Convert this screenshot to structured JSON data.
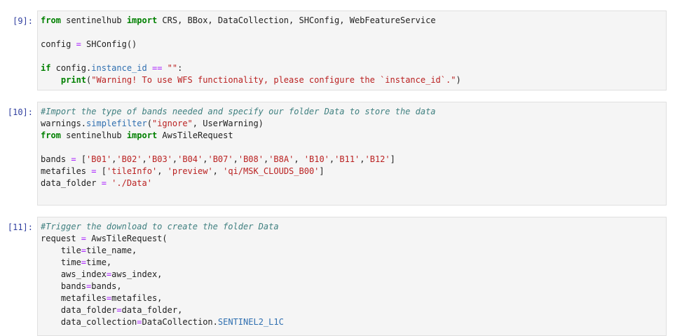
{
  "cells": [
    {
      "prompt": "[9]:",
      "lines": [
        [
          {
            "t": "from",
            "c": "kw"
          },
          {
            "t": " sentinelhub "
          },
          {
            "t": "import",
            "c": "kw"
          },
          {
            "t": " CRS, BBox, DataCollection, SHConfig, WebFeatureService"
          }
        ],
        [],
        [
          {
            "t": "config "
          },
          {
            "t": "=",
            "c": "op"
          },
          {
            "t": " SHConfig()"
          }
        ],
        [],
        [
          {
            "t": "if",
            "c": "kw"
          },
          {
            "t": " config."
          },
          {
            "t": "instance_id",
            "c": "attr"
          },
          {
            "t": " "
          },
          {
            "t": "==",
            "c": "op"
          },
          {
            "t": " "
          },
          {
            "t": "\"\"",
            "c": "str"
          },
          {
            "t": ":"
          }
        ],
        [
          {
            "t": "    "
          },
          {
            "t": "print",
            "c": "kw"
          },
          {
            "t": "("
          },
          {
            "t": "\"Warning! To use WFS functionality, please configure the `instance_id`.\"",
            "c": "str"
          },
          {
            "t": ")"
          }
        ]
      ]
    },
    {
      "prompt": "[10]:",
      "lines": [
        [
          {
            "t": "#Import the type of bands needed and specify our folder Data to store the data",
            "c": "cm"
          }
        ],
        [
          {
            "t": "warnings."
          },
          {
            "t": "simplefilter",
            "c": "attr"
          },
          {
            "t": "("
          },
          {
            "t": "\"ignore\"",
            "c": "str"
          },
          {
            "t": ", UserWarning)"
          }
        ],
        [
          {
            "t": "from",
            "c": "kw"
          },
          {
            "t": " sentinelhub "
          },
          {
            "t": "import",
            "c": "kw"
          },
          {
            "t": " AwsTileRequest"
          }
        ],
        [],
        [
          {
            "t": "bands "
          },
          {
            "t": "=",
            "c": "op"
          },
          {
            "t": " ["
          },
          {
            "t": "'B01'",
            "c": "str"
          },
          {
            "t": ","
          },
          {
            "t": "'B02'",
            "c": "str"
          },
          {
            "t": ","
          },
          {
            "t": "'B03'",
            "c": "str"
          },
          {
            "t": ","
          },
          {
            "t": "'B04'",
            "c": "str"
          },
          {
            "t": ","
          },
          {
            "t": "'B07'",
            "c": "str"
          },
          {
            "t": ","
          },
          {
            "t": "'B08'",
            "c": "str"
          },
          {
            "t": ","
          },
          {
            "t": "'B8A'",
            "c": "str"
          },
          {
            "t": ", "
          },
          {
            "t": "'B10'",
            "c": "str"
          },
          {
            "t": ","
          },
          {
            "t": "'B11'",
            "c": "str"
          },
          {
            "t": ","
          },
          {
            "t": "'B12'",
            "c": "str"
          },
          {
            "t": "]"
          }
        ],
        [
          {
            "t": "metafiles "
          },
          {
            "t": "=",
            "c": "op"
          },
          {
            "t": " ["
          },
          {
            "t": "'tileInfo'",
            "c": "str"
          },
          {
            "t": ", "
          },
          {
            "t": "'preview'",
            "c": "str"
          },
          {
            "t": ", "
          },
          {
            "t": "'qi/MSK_CLOUDS_B00'",
            "c": "str"
          },
          {
            "t": "]"
          }
        ],
        [
          {
            "t": "data_folder "
          },
          {
            "t": "=",
            "c": "op"
          },
          {
            "t": " "
          },
          {
            "t": "'./Data'",
            "c": "str"
          }
        ],
        []
      ]
    },
    {
      "prompt": "[11]:",
      "lines": [
        [
          {
            "t": "#Trigger the download to create the folder Data",
            "c": "cm"
          }
        ],
        [
          {
            "t": "request "
          },
          {
            "t": "=",
            "c": "op"
          },
          {
            "t": " AwsTileRequest("
          }
        ],
        [
          {
            "t": "    tile"
          },
          {
            "t": "=",
            "c": "op"
          },
          {
            "t": "tile_name,"
          }
        ],
        [
          {
            "t": "    time"
          },
          {
            "t": "=",
            "c": "op"
          },
          {
            "t": "time,"
          }
        ],
        [
          {
            "t": "    aws_index"
          },
          {
            "t": "=",
            "c": "op"
          },
          {
            "t": "aws_index,"
          }
        ],
        [
          {
            "t": "    bands"
          },
          {
            "t": "=",
            "c": "op"
          },
          {
            "t": "bands,"
          }
        ],
        [
          {
            "t": "    metafiles"
          },
          {
            "t": "=",
            "c": "op"
          },
          {
            "t": "metafiles,"
          }
        ],
        [
          {
            "t": "    data_folder"
          },
          {
            "t": "=",
            "c": "op"
          },
          {
            "t": "data_folder,"
          }
        ],
        [
          {
            "t": "    data_collection"
          },
          {
            "t": "=",
            "c": "op"
          },
          {
            "t": "DataCollection."
          },
          {
            "t": "SENTINEL2_L1C",
            "c": "attr"
          }
        ]
      ]
    }
  ]
}
